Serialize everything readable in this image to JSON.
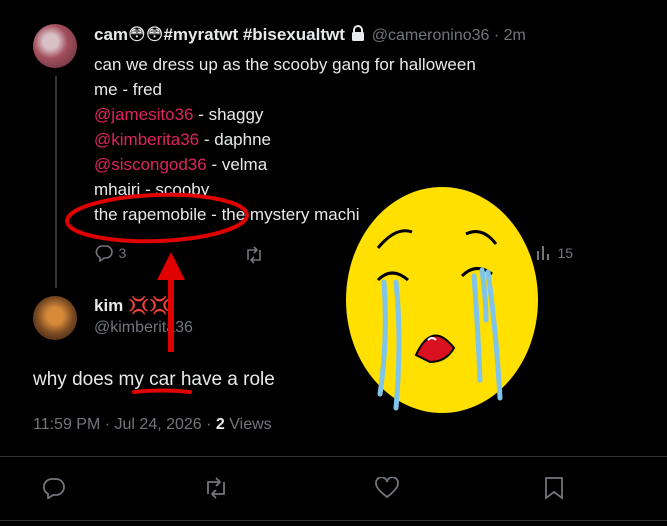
{
  "original_tweet": {
    "display_name": "cam😳😳#myratwt #bisexualtwt",
    "handle": "@cameronino36",
    "separator": "·",
    "time": "2m",
    "lines": [
      {
        "text": "can we dress up as the scooby gang for halloween"
      },
      {
        "text": "me - fred"
      },
      {
        "mention": "@jamesito36",
        "text": " - shaggy"
      },
      {
        "mention": "@kimberita36",
        "text": " - daphne"
      },
      {
        "mention": "@siscongod36",
        "text": " - velma"
      },
      {
        "text": "mhairi - scooby"
      },
      {
        "text": "the rapemobile - the mystery machi"
      }
    ],
    "reply_count": "3",
    "view_count": "15"
  },
  "reply_tweet": {
    "display_name": "kim 💢💢",
    "handle": "@kimberita36",
    "text": "why does my car have a role",
    "time": "11:59 PM · Jul 24, 2026 ·",
    "views_count": "2",
    "views_label": "Views"
  },
  "overlay": {
    "emoji": "crying-face-emoji",
    "annotation_color": "#e00000",
    "emoji_color": "#ffe000",
    "tears_color": "#7fc4ea"
  },
  "colors": {
    "mention": "#e0245e",
    "secondary": "#71767b",
    "text": "#e7e9ea"
  }
}
